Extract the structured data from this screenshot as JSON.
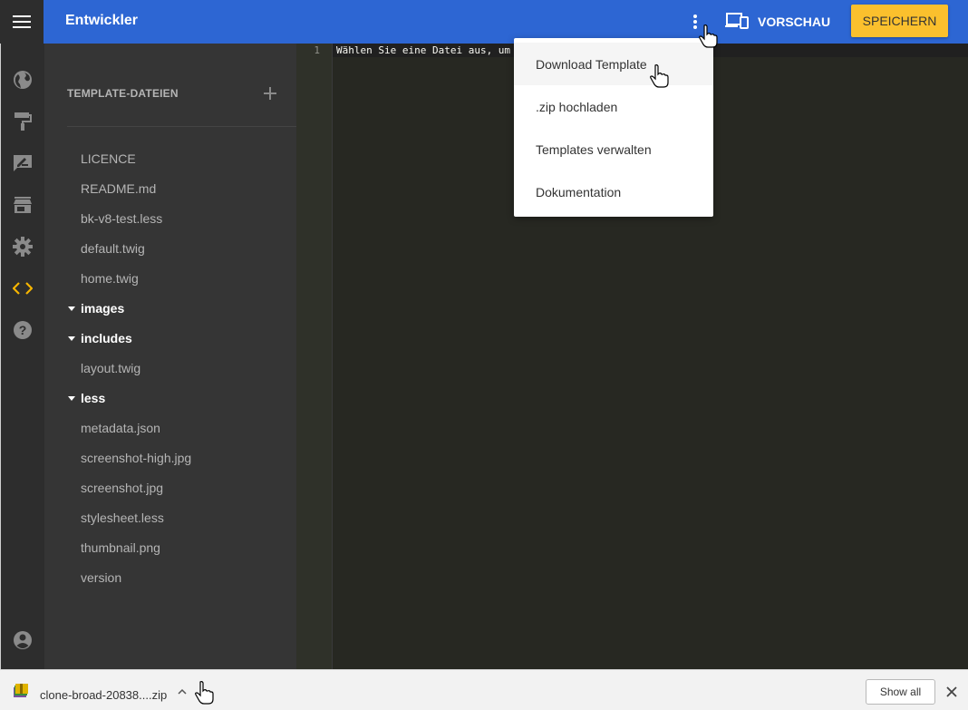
{
  "header": {
    "title": "Entwickler",
    "menu_icon": "hamburger-menu-icon",
    "more_icon": "more-vertical-icon",
    "preview_label": "VORSCHAU",
    "preview_icon": "devices-icon",
    "save_label": "SPEICHERN",
    "accent_color": "#2d66d3",
    "save_color": "#fbc02d"
  },
  "rail": {
    "items": [
      {
        "icon": "globe-icon",
        "active": false
      },
      {
        "icon": "paint-roller-icon",
        "active": false
      },
      {
        "icon": "edit-note-icon",
        "active": false
      },
      {
        "icon": "store-icon",
        "active": false
      },
      {
        "icon": "gear-icon",
        "active": false
      },
      {
        "icon": "code-icon",
        "active": true
      },
      {
        "icon": "help-icon",
        "active": false
      }
    ],
    "account_icon": "account-circle-icon",
    "active_color": "#f6b500"
  },
  "files": {
    "header": "TEMPLATE-DATEIEN",
    "add_icon": "plus-icon",
    "items": [
      {
        "name": "LICENCE",
        "type": "file"
      },
      {
        "name": "README.md",
        "type": "file"
      },
      {
        "name": "bk-v8-test.less",
        "type": "file"
      },
      {
        "name": "default.twig",
        "type": "file"
      },
      {
        "name": "home.twig",
        "type": "file"
      },
      {
        "name": "images",
        "type": "folder"
      },
      {
        "name": "includes",
        "type": "folder"
      },
      {
        "name": "layout.twig",
        "type": "file"
      },
      {
        "name": "less",
        "type": "folder"
      },
      {
        "name": "metadata.json",
        "type": "file"
      },
      {
        "name": "screenshot-high.jpg",
        "type": "file"
      },
      {
        "name": "screenshot.jpg",
        "type": "file"
      },
      {
        "name": "stylesheet.less",
        "type": "file"
      },
      {
        "name": "thumbnail.png",
        "type": "file"
      },
      {
        "name": "version",
        "type": "file"
      }
    ]
  },
  "editor": {
    "line_number": "1",
    "code_text": "Wählen Sie eine Datei aus, um"
  },
  "dropdown": {
    "items": [
      {
        "label": "Download Template",
        "hovered": true
      },
      {
        "label": ".zip hochladen",
        "hovered": false
      },
      {
        "label": "Templates verwalten",
        "hovered": false
      },
      {
        "label": "Dokumentation",
        "hovered": false
      }
    ]
  },
  "download_bar": {
    "file_name": "clone-broad-20838....zip",
    "file_icon": "zip-archive-icon",
    "chevron_icon": "chevron-up-icon",
    "show_all_label": "Show all",
    "close_icon": "close-icon"
  }
}
